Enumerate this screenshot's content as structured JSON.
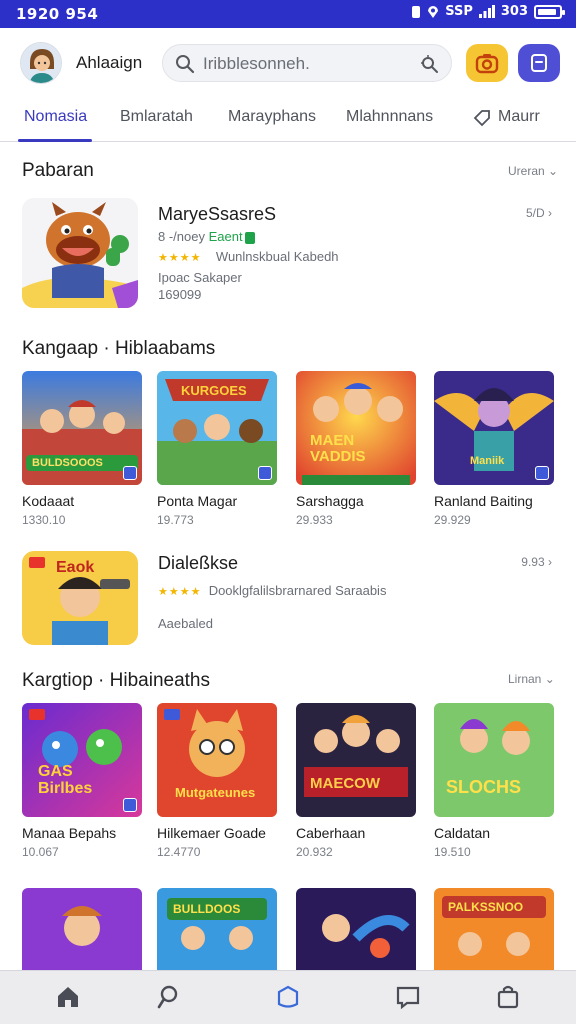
{
  "status_bar": {
    "time": "1920 954",
    "right_text": "SSP",
    "battery_text": "303"
  },
  "header": {
    "app_title": "Ahlaaign",
    "search_placeholder": "Iribblesonneh."
  },
  "tabs": [
    {
      "label": "Nomasia",
      "active": true
    },
    {
      "label": "Bmlaratah",
      "active": false
    },
    {
      "label": "Marayphans",
      "active": false
    },
    {
      "label": "Mlahnnnans",
      "active": false
    },
    {
      "label": "Maurr",
      "active": false
    }
  ],
  "section_1": {
    "title": "Pabaran",
    "more": "Ureran",
    "item": {
      "name": "MaryeSsasreS",
      "line1_prefix": "8 -/noey",
      "line1_highlight": "Eaent",
      "rating_text": "Wunlnskbual Kabedh",
      "line3": "Ipoac Sakaper",
      "line4": "169099",
      "size": "5/D"
    }
  },
  "section_2": {
    "title": "Kangaap · Hiblaabams",
    "cards": [
      {
        "name": "Kodaaat",
        "number": "1330.10",
        "banner": "BULDSOOOS"
      },
      {
        "name": "Ponta Magar",
        "number": "19.773",
        "banner": "KURGOES"
      },
      {
        "name": "Sarshagga",
        "number": "29.933",
        "banner": "MAEN VADDIS"
      },
      {
        "name": "Ranland Baiting",
        "number": "29.929",
        "banner": "Maniik"
      }
    ]
  },
  "section_3": {
    "item": {
      "name": "Dialeßkse",
      "rating_text": "Dooklgfalilsbrarnared Saraabis",
      "line3": "Aaebaled",
      "size": "9.93",
      "thumb_text": "Eaok"
    }
  },
  "section_4": {
    "title": "Kargtiop · Hibaineaths",
    "more": "Lirnan",
    "cards": [
      {
        "name": "Manaa Bepahs",
        "number": "10.067",
        "banner": "GAS Birlbes"
      },
      {
        "name": "Hilkemaer Goade",
        "number": "12.4770",
        "banner": "Mutgateunes"
      },
      {
        "name": "Caberhaan",
        "number": "20.932",
        "banner": "MAECOW"
      },
      {
        "name": "Caldatan",
        "number": "19.510",
        "banner": "SLOCHS"
      }
    ]
  },
  "section_5": {
    "cards": [
      {
        "name": "",
        "banner": ""
      },
      {
        "name": "",
        "banner": "BULLDOOS"
      },
      {
        "name": "",
        "banner": ""
      },
      {
        "name": "",
        "banner": "PALKSSNOO"
      }
    ]
  },
  "bottom_nav": {
    "items": [
      {
        "icon": "home-icon"
      },
      {
        "icon": "search-pin-icon"
      },
      {
        "icon": "shield-icon",
        "active": true
      },
      {
        "icon": "chat-bubble-icon"
      },
      {
        "icon": "bag-icon"
      }
    ]
  },
  "colors": {
    "status_bar": "#2d2fc9",
    "accent": "#3a3ac0",
    "camera_button": "#f6c533",
    "chat_button": "#4f4fd6",
    "star": "#f2b600",
    "verified_green": "#1ea34a"
  }
}
